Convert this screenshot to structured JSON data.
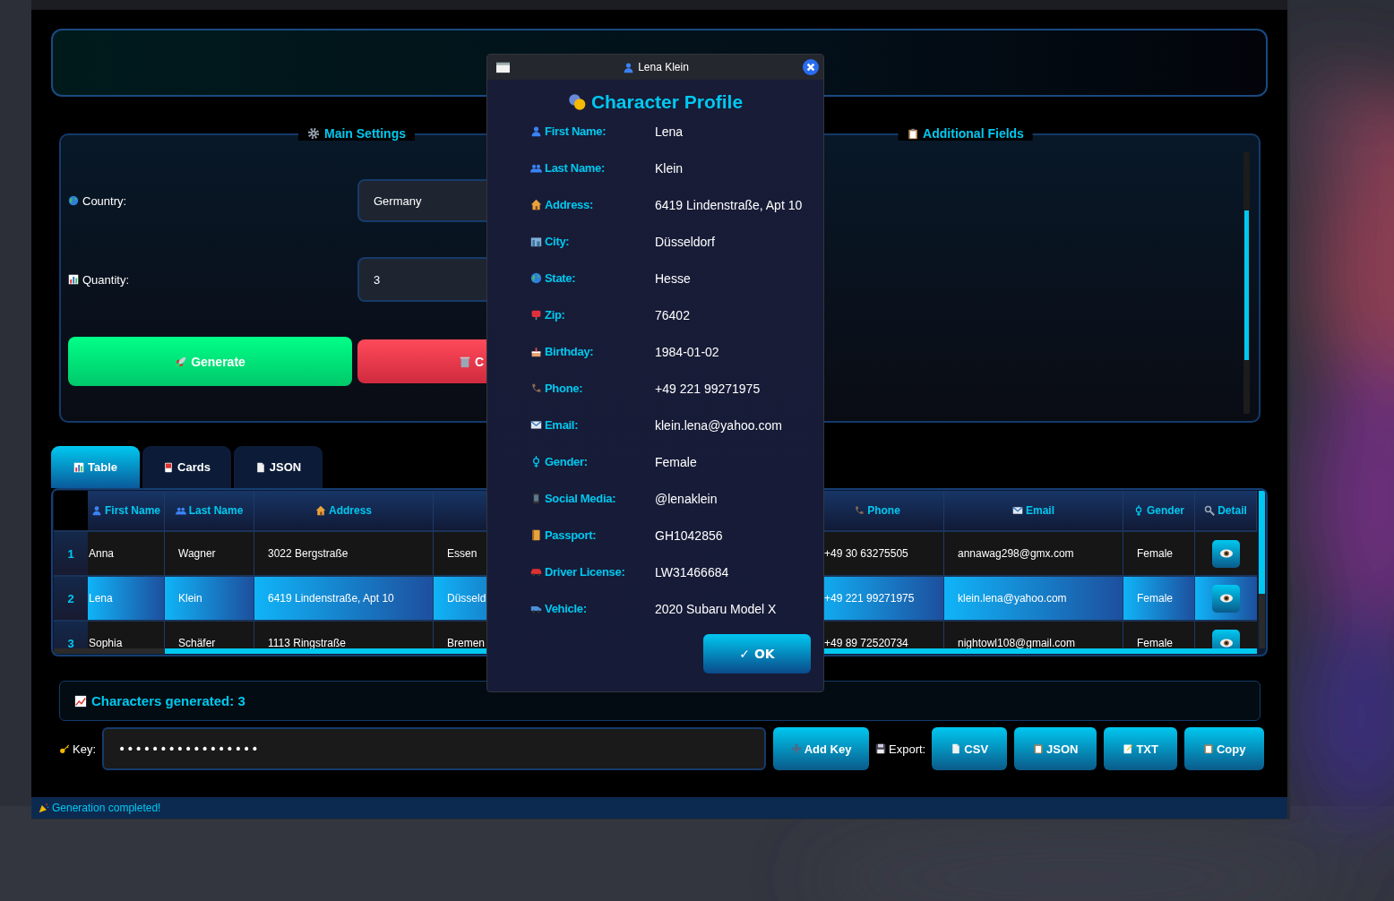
{
  "main_settings": {
    "title": "Main Settings",
    "fields": [
      {
        "label": "Country:",
        "value": "Germany"
      },
      {
        "label": "Quantity:",
        "value": "3"
      }
    ],
    "buttons": [
      {
        "label": "Generate",
        "kind": "generate"
      },
      {
        "label": "C",
        "kind": "clear"
      }
    ]
  },
  "additional_fields": {
    "title": "Additional Fields"
  },
  "tabs": [
    {
      "label": "Table",
      "selected": true
    },
    {
      "label": "Cards",
      "selected": false
    },
    {
      "label": "JSON",
      "selected": false
    }
  ],
  "table": {
    "columns": [
      "First Name",
      "Last Name",
      "Address",
      "",
      "Phone",
      "Email",
      "Gender",
      "Detail"
    ],
    "rows": [
      {
        "number": "1",
        "selected": false,
        "cells": [
          "Anna",
          "Wagner",
          "3022 Bergstraße",
          "Essen",
          "+49 30 63275505",
          "annawag298@gmx.com",
          "Female"
        ]
      },
      {
        "number": "2",
        "selected": true,
        "cells": [
          "Lena",
          "Klein",
          "6419 Lindenstraße, Apt 10",
          "Düsseld",
          "+49 221 99271975",
          "klein.lena@yahoo.com",
          "Female"
        ]
      },
      {
        "number": "3",
        "selected": false,
        "cells": [
          "Sophia",
          "Schäfer",
          "1113 Ringstraße",
          "Bremen",
          "+49 89 72520734",
          "nightowl108@gmail.com",
          "Female"
        ]
      }
    ]
  },
  "stats": "Characters generated: 3",
  "key": {
    "label": "Key:",
    "value": "•••••••••••••••••",
    "button": "Add Key"
  },
  "export": {
    "label": "Export:",
    "buttons": [
      "CSV",
      "JSON",
      "TXT",
      "Copy"
    ]
  },
  "status_bar": "Generation completed!",
  "dialog": {
    "title": "Lena Klein",
    "heading": "Character Profile",
    "fields": [
      {
        "label": "First Name:",
        "value": "Lena"
      },
      {
        "label": "Last Name:",
        "value": "Klein"
      },
      {
        "label": "Address:",
        "value": "6419 Lindenstraße, Apt 10"
      },
      {
        "label": "City:",
        "value": "Düsseldorf"
      },
      {
        "label": "State:",
        "value": "Hesse"
      },
      {
        "label": "Zip:",
        "value": "76402"
      },
      {
        "label": "Birthday:",
        "value": "1984-01-02"
      },
      {
        "label": "Phone:",
        "value": "+49 221 99271975"
      },
      {
        "label": "Email:",
        "value": "klein.lena@yahoo.com"
      },
      {
        "label": "Gender:",
        "value": "Female"
      },
      {
        "label": "Social Media:",
        "value": "@lenaklein"
      },
      {
        "label": "Passport:",
        "value": "GH1042856"
      },
      {
        "label": "Driver License:",
        "value": "LW31466684"
      },
      {
        "label": "Vehicle:",
        "value": "2020 Subaru Model X"
      }
    ],
    "ok_button": "✓ OK"
  }
}
